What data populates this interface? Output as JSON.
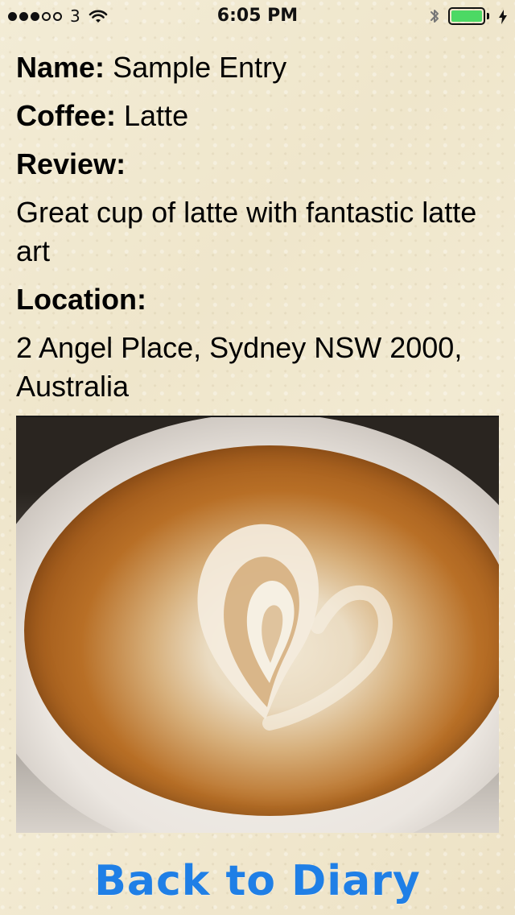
{
  "status_bar": {
    "carrier": "3",
    "time": "6:05 PM",
    "signal_bars_total": 5,
    "signal_bars_filled": 3,
    "battery_level_percent": 100,
    "battery_color": "#4cd964",
    "icons": {
      "wifi": "wifi-icon",
      "bluetooth": "bluetooth-icon",
      "charging": "charging-icon"
    }
  },
  "entry": {
    "name_label": "Name:",
    "name_value": "Sample Entry",
    "coffee_label": "Coffee:",
    "coffee_value": "Latte",
    "review_label": "Review:",
    "review_text": "Great cup of latte with fantastic latte art",
    "location_label": "Location:",
    "location_text": "2 Angel Place, Sydney NSW 2000, Australia",
    "photo_subject": "latte-art-photo"
  },
  "actions": {
    "back_label": "Back to Diary"
  },
  "colors": {
    "accent": "#1f7fe6",
    "text": "#000000"
  }
}
